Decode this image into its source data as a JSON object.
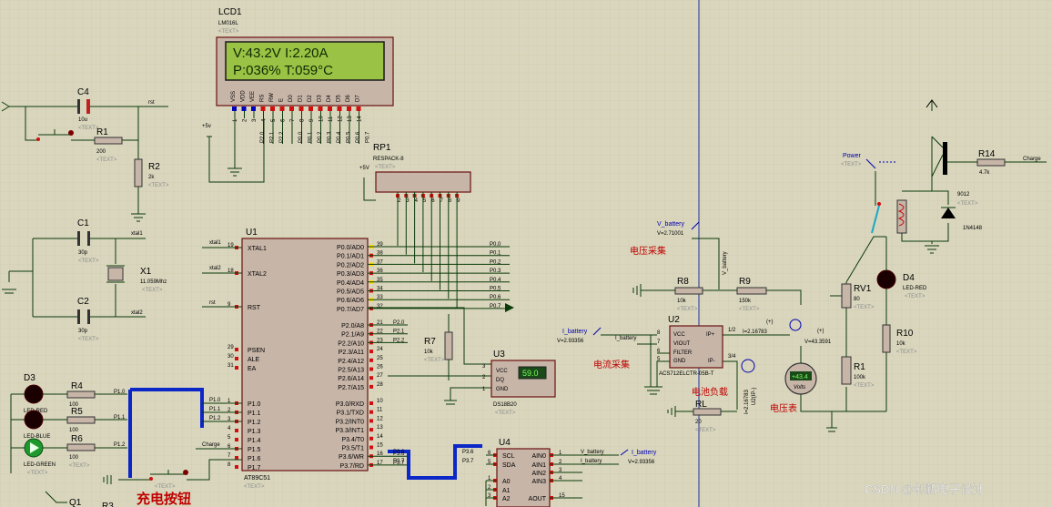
{
  "schematic": {
    "lcd": {
      "ref": "LCD1",
      "part": "LM016L",
      "text": "<TEXT>",
      "line1": "V:43.2V  I:2.20A",
      "line2": "P:036%   T:059°C",
      "pins": [
        "VSS",
        "VDD",
        "VEE",
        "RS",
        "RW",
        "E",
        "D0",
        "D1",
        "D2",
        "D3",
        "D4",
        "D5",
        "D6",
        "D7"
      ],
      "pin_nums": [
        "1",
        "2",
        "3",
        "4",
        "5",
        "6",
        "7",
        "8",
        "9",
        "10",
        "11",
        "12",
        "13",
        "14"
      ],
      "nets": [
        "P2.0",
        "P2.1",
        "P2.2",
        "P0.0",
        "P0.1",
        "P0.2",
        "P0.3",
        "P0.4",
        "P0.5",
        "P0.6",
        "P0.7"
      ],
      "vcc": "+5v"
    },
    "rp1": {
      "ref": "RP1",
      "part": "RESPACK-8",
      "text": "<TEXT>",
      "vcc": "+5V"
    },
    "u1": {
      "ref": "U1",
      "part": "AT89C51",
      "text": "<TEXT>",
      "left_pins": [
        {
          "n": "19",
          "name": "XTAL1",
          "net": "xtal1"
        },
        {
          "n": "18",
          "name": "XTAL2",
          "net": "xtal2"
        },
        {
          "n": "9",
          "name": "RST",
          "net": "rst"
        },
        {
          "n": "29",
          "name": "PSEN"
        },
        {
          "n": "30",
          "name": "ALE"
        },
        {
          "n": "31",
          "name": "EA"
        },
        {
          "n": "1",
          "name": "P1.0",
          "net": "P1.0"
        },
        {
          "n": "2",
          "name": "P1.1",
          "net": "P1.1"
        },
        {
          "n": "3",
          "name": "P1.2",
          "net": "P1.2"
        },
        {
          "n": "4",
          "name": "P1.3"
        },
        {
          "n": "5",
          "name": "P1.4"
        },
        {
          "n": "6",
          "name": "P1.5",
          "net": "Charge"
        },
        {
          "n": "7",
          "name": "P1.6"
        },
        {
          "n": "8",
          "name": "P1.7"
        }
      ],
      "right_pins": [
        {
          "n": "39",
          "name": "P0.0/AD0"
        },
        {
          "n": "38",
          "name": "P0.1/AD1"
        },
        {
          "n": "37",
          "name": "P0.2/AD2"
        },
        {
          "n": "36",
          "name": "P0.3/AD3"
        },
        {
          "n": "35",
          "name": "P0.4/AD4"
        },
        {
          "n": "34",
          "name": "P0.5/AD5"
        },
        {
          "n": "33",
          "name": "P0.6/AD6"
        },
        {
          "n": "32",
          "name": "P0.7/AD7"
        },
        {
          "n": "21",
          "name": "P2.0/A8",
          "net": "P2.0"
        },
        {
          "n": "22",
          "name": "P2.1/A9",
          "net": "P2.1"
        },
        {
          "n": "23",
          "name": "P2.2/A10",
          "net": "P2.2"
        },
        {
          "n": "24",
          "name": "P2.3/A11"
        },
        {
          "n": "25",
          "name": "P2.4/A12"
        },
        {
          "n": "26",
          "name": "P2.5/A13"
        },
        {
          "n": "27",
          "name": "P2.6/A14"
        },
        {
          "n": "28",
          "name": "P2.7/A15"
        },
        {
          "n": "10",
          "name": "P3.0/RXD"
        },
        {
          "n": "11",
          "name": "P3.1/TXD"
        },
        {
          "n": "12",
          "name": "P3.2/INT0"
        },
        {
          "n": "13",
          "name": "P3.3/INT1"
        },
        {
          "n": "14",
          "name": "P3.4/T0"
        },
        {
          "n": "15",
          "name": "P3.5/T1"
        },
        {
          "n": "16",
          "name": "P3.6/WR",
          "net": "P3.6"
        },
        {
          "n": "17",
          "name": "P3.7/RD",
          "net": "P3.7"
        }
      ],
      "p0_nets": [
        "P0.0",
        "P0.1",
        "P0.2",
        "P0.3",
        "P0.4",
        "P0.5",
        "P0.6",
        "P0.7"
      ]
    },
    "c4": {
      "ref": "C4",
      "val": "10u",
      "text": "<TEXT>",
      "net": "rst"
    },
    "r1a": {
      "ref": "R1",
      "val": "200",
      "text": "<TEXT>"
    },
    "r2": {
      "ref": "R2",
      "val": "2k",
      "text": "<TEXT>"
    },
    "c1": {
      "ref": "C1",
      "val": "30p",
      "text": "<TEXT>",
      "net": "xtal1"
    },
    "c2": {
      "ref": "C2",
      "val": "30p",
      "text": "<TEXT>",
      "net": "xtal2"
    },
    "x1": {
      "ref": "X1",
      "val": "11.059Mhz",
      "text": "<TEXT>"
    },
    "d3": {
      "ref": "D3",
      "val": "LED-RED"
    },
    "d5": {
      "val": "LED-BLUE"
    },
    "d6": {
      "val": "LED-GREEN",
      "text": "<TEXT>"
    },
    "r4": {
      "ref": "R4",
      "val": "100",
      "net": "P1.0"
    },
    "r5": {
      "ref": "R5",
      "val": "100",
      "net": "P1.1"
    },
    "r6": {
      "ref": "R6",
      "val": "100",
      "text": "<TEXT>",
      "net": "P1.2"
    },
    "q1": {
      "ref": "Q1"
    },
    "r3": {
      "ref": "R3"
    },
    "charge_btn": {
      "cn": "充电按钮",
      "text": "<TEXT>"
    },
    "r7": {
      "ref": "R7",
      "val": "10k",
      "text": "<TEXT>"
    },
    "u3": {
      "ref": "U3",
      "part": "DS18B20",
      "text": "<TEXT>",
      "reading": "59.0",
      "pins": [
        "VCC",
        "DQ",
        "GND"
      ],
      "pin_nums": [
        "3",
        "2",
        "1"
      ]
    },
    "u4": {
      "ref": "U4",
      "pins": [
        "SCL",
        "SDA",
        "A0",
        "A1",
        "A2"
      ],
      "pin_nums": [
        "6",
        "5",
        "1",
        "2",
        "3"
      ],
      "ain": [
        "AIN0",
        "AIN1",
        "AIN2",
        "AIN3",
        "AOUT"
      ],
      "ain_nums": [
        "1",
        "2",
        "3",
        "4",
        "15"
      ],
      "nets": {
        "scl": "P3.6",
        "sda": "P3.7",
        "v": "V_battery",
        "i": "I_battery"
      }
    },
    "probe_i2": {
      "name": "I_battery",
      "val": "V=2.93356"
    },
    "voltage_section": {
      "cn": "电压采集",
      "probe_name": "V_battery",
      "probe_val": "V=2.71001",
      "net": "V_battery"
    },
    "current_section": {
      "cn": "电流采集"
    },
    "load_section": {
      "cn": "电池负载"
    },
    "voltmeter_section": {
      "cn": "电压表",
      "reading": "+43.4",
      "unit": "Volts",
      "probe": "V=43.3591"
    },
    "r8": {
      "ref": "R8",
      "val": "10k",
      "text": "<TEXT>"
    },
    "r9": {
      "ref": "R9",
      "val": "150k",
      "text": "<TEXT>"
    },
    "u2": {
      "ref": "U2",
      "part": "ACS712ELCTR-05B-T",
      "pins": [
        "VCC",
        "VIOUT",
        "FILTER",
        "GND"
      ],
      "pin_nums": [
        "8",
        "7",
        "6",
        "5"
      ],
      "ip": [
        "IP+",
        "IP-"
      ],
      "ip_nums": [
        "1/2",
        "3/4"
      ],
      "probe_name": "I_battery",
      "probe_val": "V=2.93356",
      "i_label": "I=2.16783",
      "i_label2": "U2(IP-)",
      "net": "I_battery"
    },
    "rl": {
      "ref": "RL",
      "val": "20",
      "text": "<TEXT>"
    },
    "rv1": {
      "ref": "RV1",
      "val": "80",
      "text": "<TEXT>"
    },
    "r1b": {
      "ref": "R1",
      "val": "100k",
      "text": "<TEXT>"
    },
    "r10": {
      "ref": "R10",
      "val": "10k",
      "text": "<TEXT>"
    },
    "d4": {
      "ref": "D4",
      "val": "LED-RED",
      "text": "<TEXT>"
    },
    "power": {
      "name": "Power",
      "text": "<TEXT>"
    },
    "r14": {
      "ref": "R14",
      "val": "4.7k",
      "net": "Charge"
    },
    "q9012": {
      "val": "9012",
      "text": "<TEXT>"
    },
    "diode": {
      "val": "1N4148"
    },
    "watermark": "CSDN @创新电子设计",
    "colors": {
      "sheet": "#d9d6bd",
      "grid": "#c8c4a8",
      "lcd_bg": "#98c34a",
      "bus": "#0c27c8",
      "body": "#c7b5a8",
      "body_stroke": "#6b1010"
    }
  }
}
